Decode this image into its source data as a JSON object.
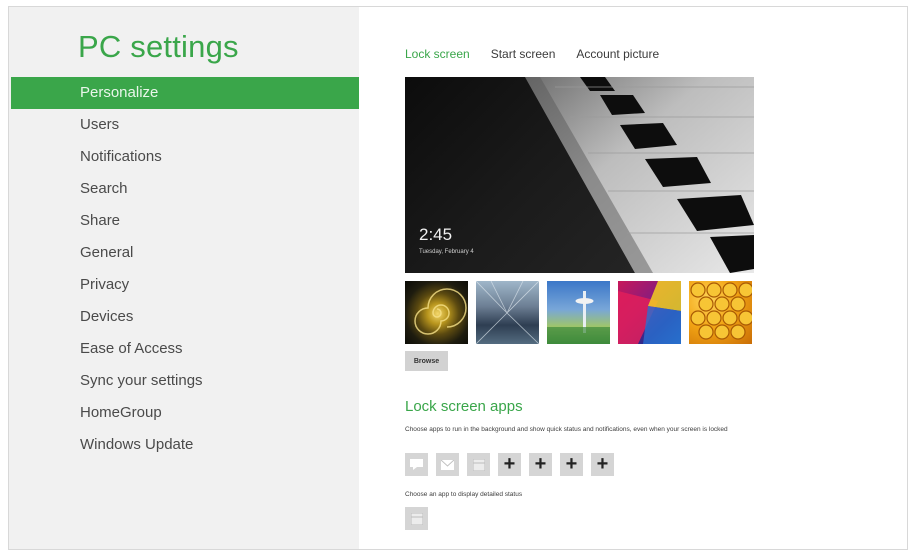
{
  "app_title": "PC settings",
  "nav": {
    "items": [
      {
        "label": "Personalize",
        "active": true
      },
      {
        "label": "Users",
        "active": false
      },
      {
        "label": "Notifications",
        "active": false
      },
      {
        "label": "Search",
        "active": false
      },
      {
        "label": "Share",
        "active": false
      },
      {
        "label": "General",
        "active": false
      },
      {
        "label": "Privacy",
        "active": false
      },
      {
        "label": "Devices",
        "active": false
      },
      {
        "label": "Ease of Access",
        "active": false
      },
      {
        "label": "Sync your settings",
        "active": false
      },
      {
        "label": "HomeGroup",
        "active": false
      },
      {
        "label": "Windows Update",
        "active": false
      }
    ]
  },
  "tabs": [
    {
      "label": "Lock screen",
      "active": true
    },
    {
      "label": "Start screen",
      "active": false
    },
    {
      "label": "Account picture",
      "active": false
    }
  ],
  "preview": {
    "time": "2:45",
    "date": "Tuesday, February 4",
    "icon": "piano-keys-image"
  },
  "thumbnails": [
    {
      "icon": "nautilus-shell-image"
    },
    {
      "icon": "hallway-image"
    },
    {
      "icon": "space-needle-image"
    },
    {
      "icon": "abstract-color-image"
    },
    {
      "icon": "honeycomb-image"
    }
  ],
  "browse_label": "Browse",
  "lock_screen_apps": {
    "title": "Lock screen apps",
    "description": "Choose apps to run in the background and show quick status and notifications, even when your screen is locked",
    "slots": [
      {
        "icon": "message-icon"
      },
      {
        "icon": "mail-icon"
      },
      {
        "icon": "calendar-icon"
      },
      {
        "icon": "plus-icon",
        "text": "+"
      },
      {
        "icon": "plus-icon",
        "text": "+"
      },
      {
        "icon": "plus-icon",
        "text": "+"
      },
      {
        "icon": "plus-icon",
        "text": "+"
      }
    ],
    "detailed_label": "Choose an app to display detailed status",
    "detailed_icon": "calendar-icon"
  },
  "colors": {
    "accent": "#3aa64a",
    "sidebar_bg": "#f1f1f1",
    "slot_bg": "#d5d5d5"
  }
}
